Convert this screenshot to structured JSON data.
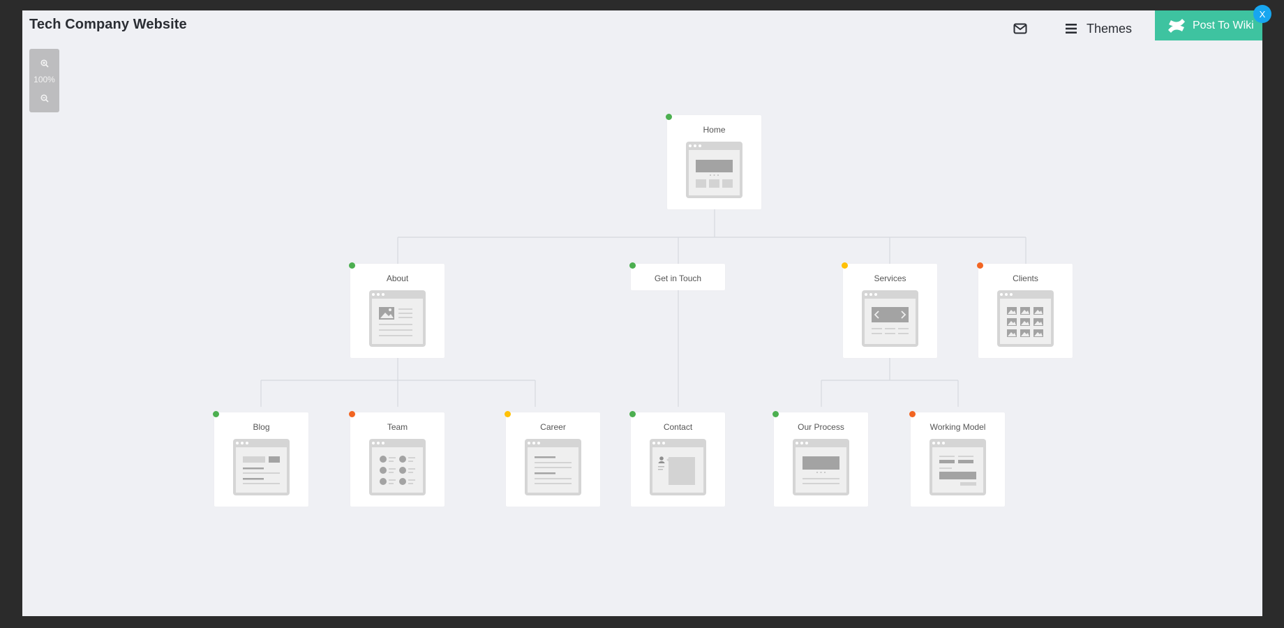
{
  "modal": {
    "title": "Tech Company Website",
    "themes_label": "Themes",
    "post_label": "Post To Wiki",
    "close_label": "X"
  },
  "zoom": {
    "level": "100%"
  },
  "colors": {
    "accent_green": "#3ec3a0",
    "close_blue": "#17a6f0",
    "status_green": "#4caf50",
    "status_yellow": "#ffc107",
    "status_orange": "#f26522",
    "line": "#d5d8de"
  },
  "nodes": [
    {
      "id": "home",
      "label": "Home",
      "status": "green",
      "icon": "landing-wireframe-icon"
    },
    {
      "id": "about",
      "label": "About",
      "status": "green",
      "icon": "image-text-wireframe-icon"
    },
    {
      "id": "get-in-touch",
      "label": "Get in Touch",
      "status": "green",
      "icon": ""
    },
    {
      "id": "services",
      "label": "Services",
      "status": "yellow",
      "icon": "slider-wireframe-icon"
    },
    {
      "id": "clients",
      "label": "Clients",
      "status": "orange",
      "icon": "gallery-wireframe-icon"
    },
    {
      "id": "blog",
      "label": "Blog",
      "status": "green",
      "icon": "blog-wireframe-icon"
    },
    {
      "id": "team",
      "label": "Team",
      "status": "orange",
      "icon": "team-wireframe-icon"
    },
    {
      "id": "career",
      "label": "Career",
      "status": "yellow",
      "icon": "text-wireframe-icon"
    },
    {
      "id": "contact",
      "label": "Contact",
      "status": "green",
      "icon": "contact-wireframe-icon"
    },
    {
      "id": "our-process",
      "label": "Our Process",
      "status": "green",
      "icon": "hero-wireframe-icon"
    },
    {
      "id": "working-model",
      "label": "Working Model",
      "status": "orange",
      "icon": "columns-wireframe-icon"
    }
  ]
}
